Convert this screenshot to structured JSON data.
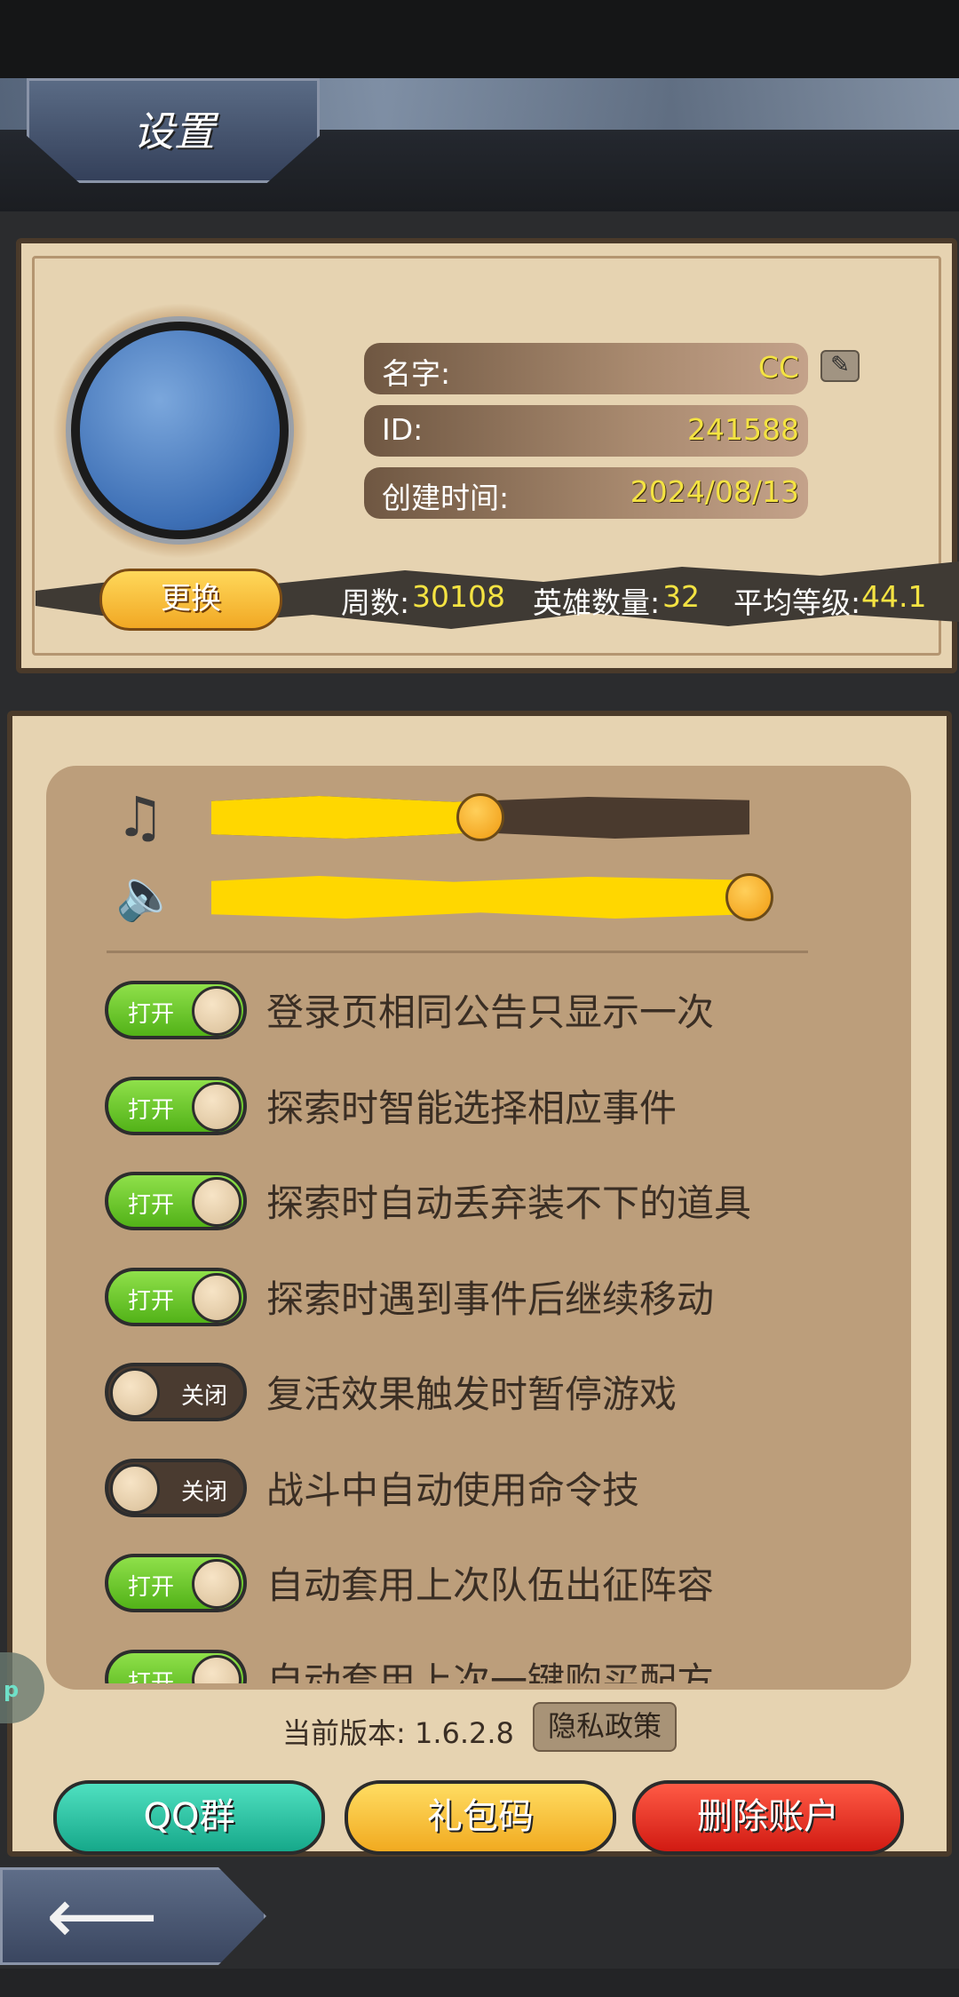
{
  "header": {
    "title": "设置"
  },
  "profile": {
    "name_label": "名字:",
    "name_value": "CC",
    "id_label": "ID:",
    "id_value": "241588",
    "created_label": "创建时间:",
    "created_value": "2024/08/13",
    "change_button": "更换",
    "stats": {
      "weeks_label": "周数:",
      "weeks_value": "30108",
      "heroes_label": "英雄数量:",
      "heroes_value": "32",
      "avg_level_label": "平均等级:",
      "avg_level_value": "44.1"
    }
  },
  "audio": {
    "music_icon": "music-note-icon",
    "music_level": 0.5,
    "sound_icon": "speaker-icon",
    "sound_level": 1.0
  },
  "options": [
    {
      "state": "打开",
      "on": true,
      "label": "登录页相同公告只显示一次"
    },
    {
      "state": "打开",
      "on": true,
      "label": "探索时智能选择相应事件"
    },
    {
      "state": "打开",
      "on": true,
      "label": "探索时自动丢弃装不下的道具"
    },
    {
      "state": "打开",
      "on": true,
      "label": "探索时遇到事件后继续移动"
    },
    {
      "state": "关闭",
      "on": false,
      "label": "复活效果触发时暂停游戏"
    },
    {
      "state": "关闭",
      "on": false,
      "label": "战斗中自动使用命令技"
    },
    {
      "state": "打开",
      "on": true,
      "label": "自动套用上次队伍出征阵容"
    },
    {
      "state": "打开",
      "on": true,
      "label": "自动套用上次一键购买配方"
    }
  ],
  "footer": {
    "version": "当前版本: 1.6.2.8",
    "privacy": "隐私政策",
    "qq": "QQ群",
    "gift_code": "礼包码",
    "delete_account": "删除账户"
  },
  "side_badge": "p",
  "colors": {
    "accent_yellow": "#ffd700",
    "toggle_on": "#52b218",
    "toggle_off": "#4a3b30",
    "panel": "#e6d3b1"
  }
}
